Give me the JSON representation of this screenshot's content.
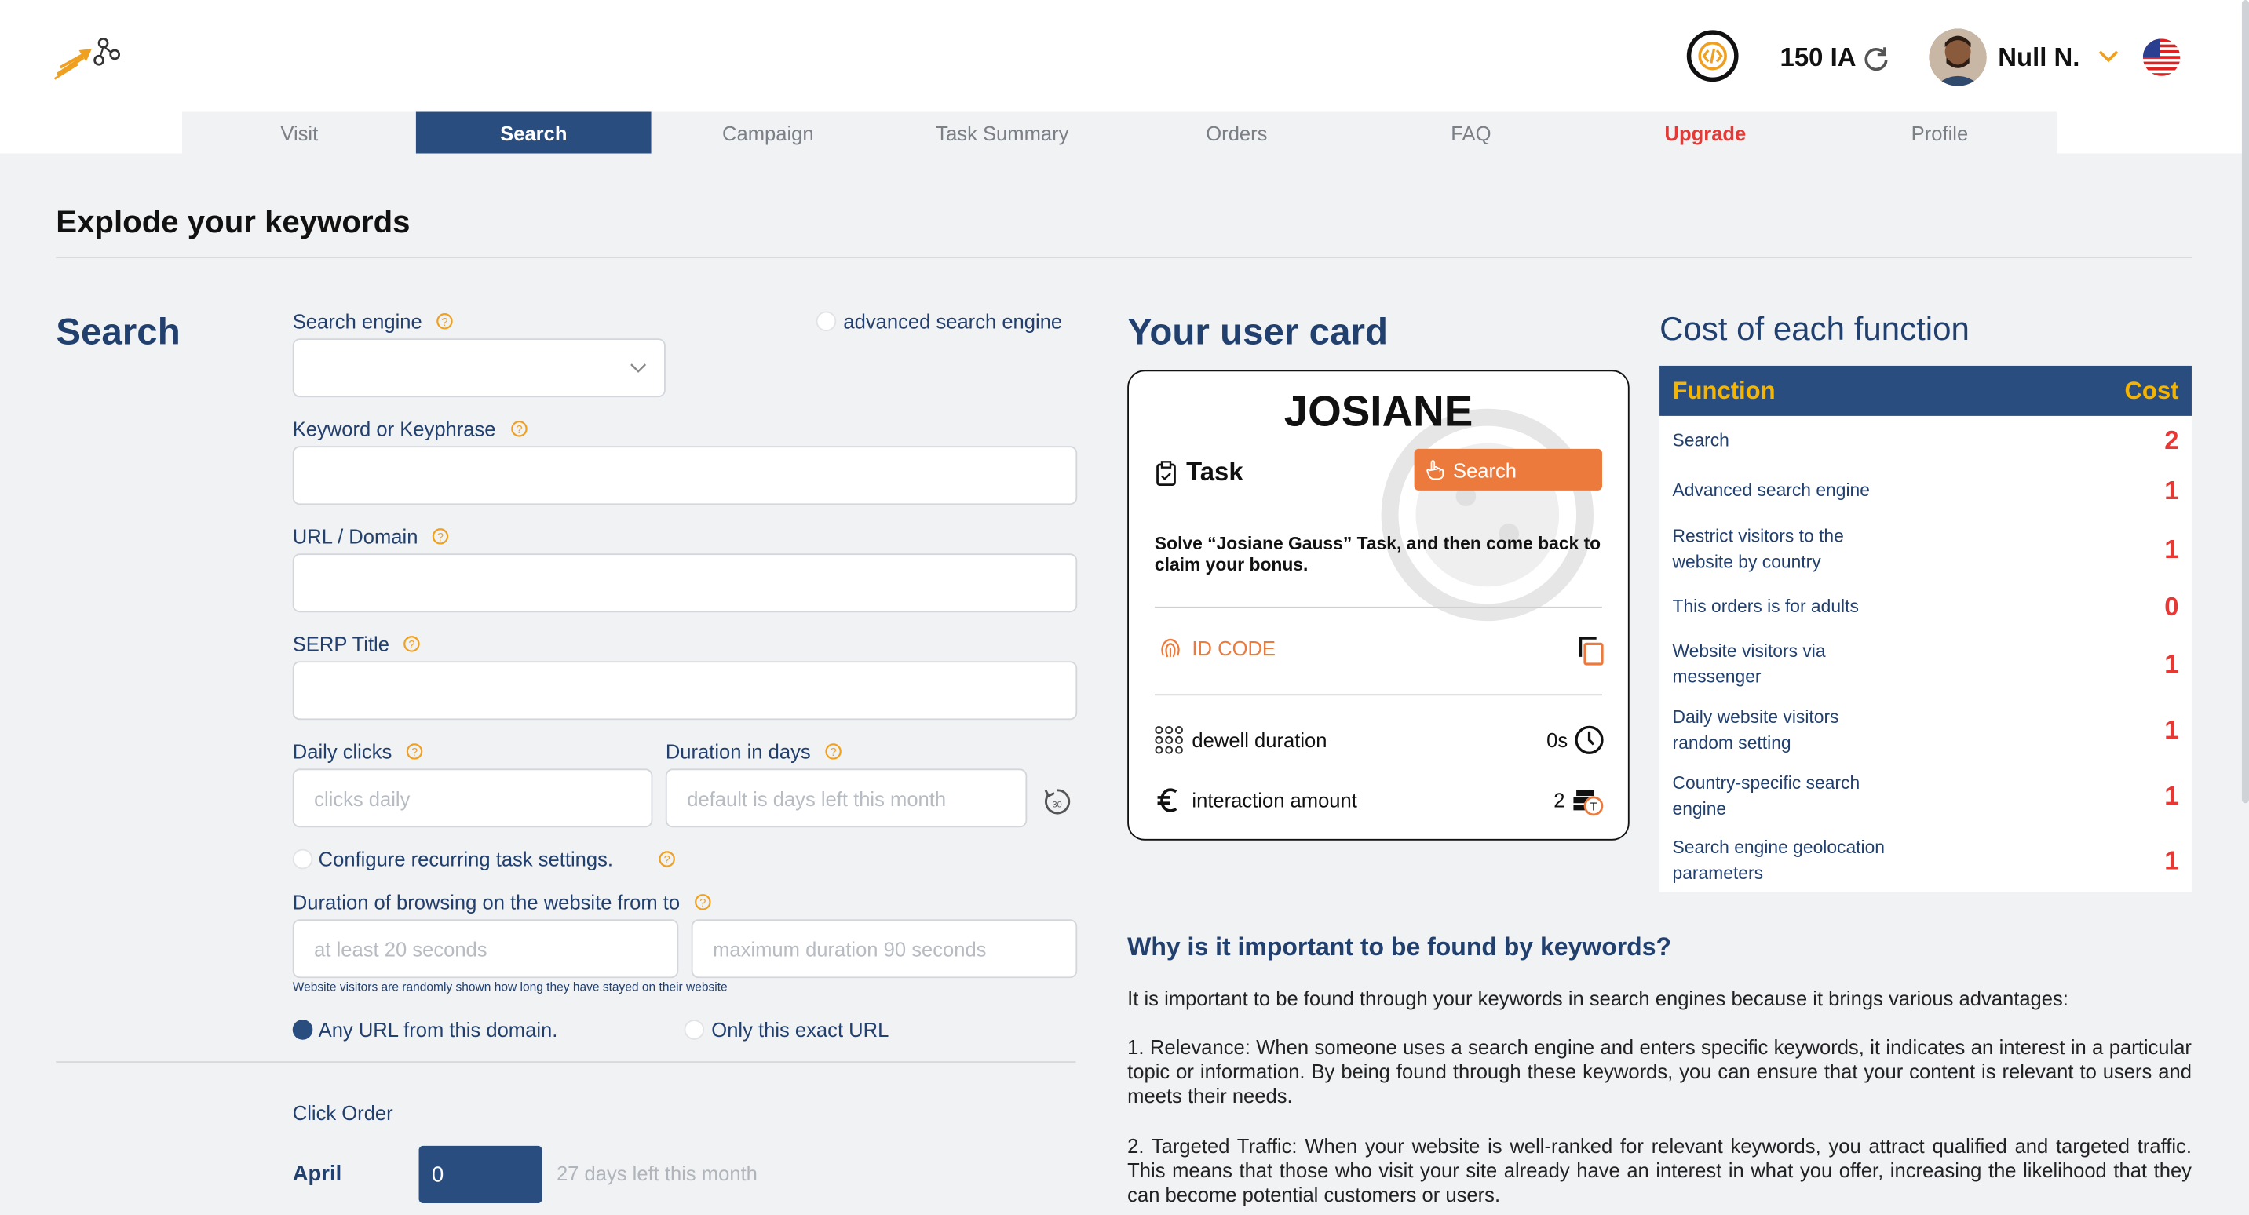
{
  "header": {
    "credits": "150 IA",
    "username": "Null N."
  },
  "nav": {
    "tabs": [
      "Visit",
      "Search",
      "Campaign",
      "Task Summary",
      "Orders",
      "FAQ",
      "Upgrade",
      "Profile"
    ],
    "active": "Search"
  },
  "page": {
    "title": "Explode your keywords"
  },
  "form": {
    "section_title": "Search",
    "search_engine_label": "Search engine",
    "advanced_label": "advanced search engine",
    "keyword_label": "Keyword or Keyphrase",
    "url_label": "URL / Domain",
    "serp_label": "SERP Title",
    "daily_clicks_label": "Daily clicks",
    "daily_clicks_placeholder": "clicks daily",
    "duration_days_label": "Duration in days",
    "duration_days_placeholder": "default is days left this month",
    "recurring_label": "Configure recurring task settings.",
    "browsing_label": "Duration of browsing on the website from to",
    "browsing_min_placeholder": "at least 20 seconds",
    "browsing_max_placeholder": "maximum duration 90 seconds",
    "browsing_note": "Website visitors are randomly shown how long they have stayed on their website",
    "any_url_label": "Any URL from this domain.",
    "exact_url_label": "Only this exact URL",
    "click_order_label": "Click Order",
    "month_label": "April",
    "month_value": "0",
    "days_left": "27 days left this month"
  },
  "user_card": {
    "section_title": "Your user card",
    "name": "JOSIANE",
    "task_label": "Task",
    "search_button": "Search",
    "description": "Solve “Josiane Gauss” Task, and then come back to claim your bonus.",
    "id_code_label": "ID CODE",
    "dwell_label": "dewell duration",
    "dwell_value": "0s",
    "interaction_label": "interaction amount",
    "interaction_value": "2"
  },
  "cost": {
    "section_title": "Cost of each function",
    "head_function": "Function",
    "head_cost": "Cost",
    "rows": [
      {
        "name": "Search",
        "cost": "2"
      },
      {
        "name": "Advanced search engine",
        "cost": "1"
      },
      {
        "name": "Restrict visitors to the website by country",
        "cost": "1"
      },
      {
        "name": "This orders is for adults",
        "cost": "0"
      },
      {
        "name": "Website visitors via messenger",
        "cost": "1"
      },
      {
        "name": "Daily website visitors random setting",
        "cost": "1"
      },
      {
        "name": "Country-specific search engine",
        "cost": "1"
      },
      {
        "name": "Search engine geolocation parameters",
        "cost": "1"
      }
    ]
  },
  "why": {
    "title": "Why is it important to be found by keywords?",
    "intro": "It is important to be found through your keywords in search engines because it brings various advantages:",
    "p1": "1. Relevance: When someone uses a search engine and enters specific keywords, it indicates an interest in a particular topic or information. By being found through these keywords, you can ensure that your content is relevant to users and meets their needs.",
    "p2": "2. Targeted Traffic: When your website is well-ranked for relevant keywords, you attract qualified and targeted traffic. This means that those who visit your site already have an interest in what you offer, increasing the likelihood that they can become potential customers or users."
  }
}
